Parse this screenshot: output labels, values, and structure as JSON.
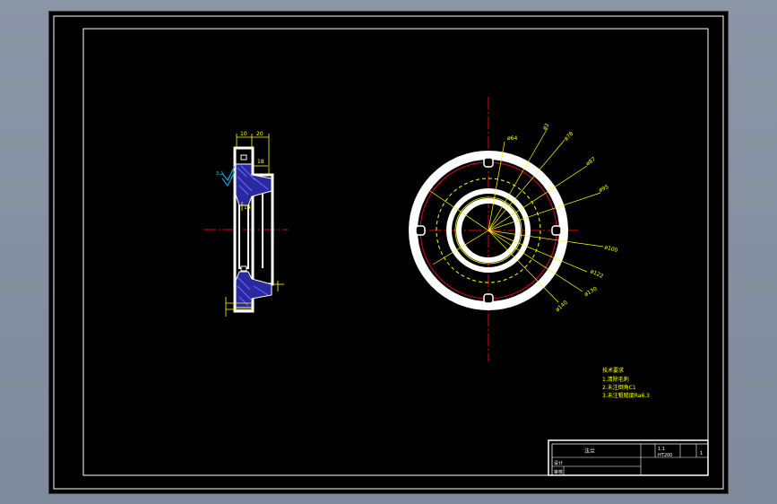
{
  "colors": {
    "background": "#000000",
    "border": "#ffffff",
    "centerline": "#e0001b",
    "dimension": "#ffff00",
    "hatch": "#3030c8",
    "part": "#ffffff",
    "pcd_circle": "#e0001b",
    "dashed_circle": "#ffff00"
  },
  "section_view": {
    "dim_top_left": "10",
    "dim_top_right": "20",
    "dim_mid": "18",
    "dim_inner": "14",
    "surface_mark": "3.2"
  },
  "front_view": {
    "callouts": [
      "ø64",
      "ø3",
      "ø78",
      "ø87",
      "ø95",
      "ø100",
      "ø122",
      "ø130",
      "ø140"
    ]
  },
  "notes": {
    "title": "技术要求",
    "lines": [
      "1.清除毛刺",
      "2.未注倒角C1",
      "3.未注粗糙度Ra6.3"
    ]
  },
  "title_block": {
    "part_name": "法兰",
    "scale": "1:1",
    "material": "HT200",
    "sheet": "1",
    "row_label_1": "设计",
    "row_label_2": "审核"
  }
}
